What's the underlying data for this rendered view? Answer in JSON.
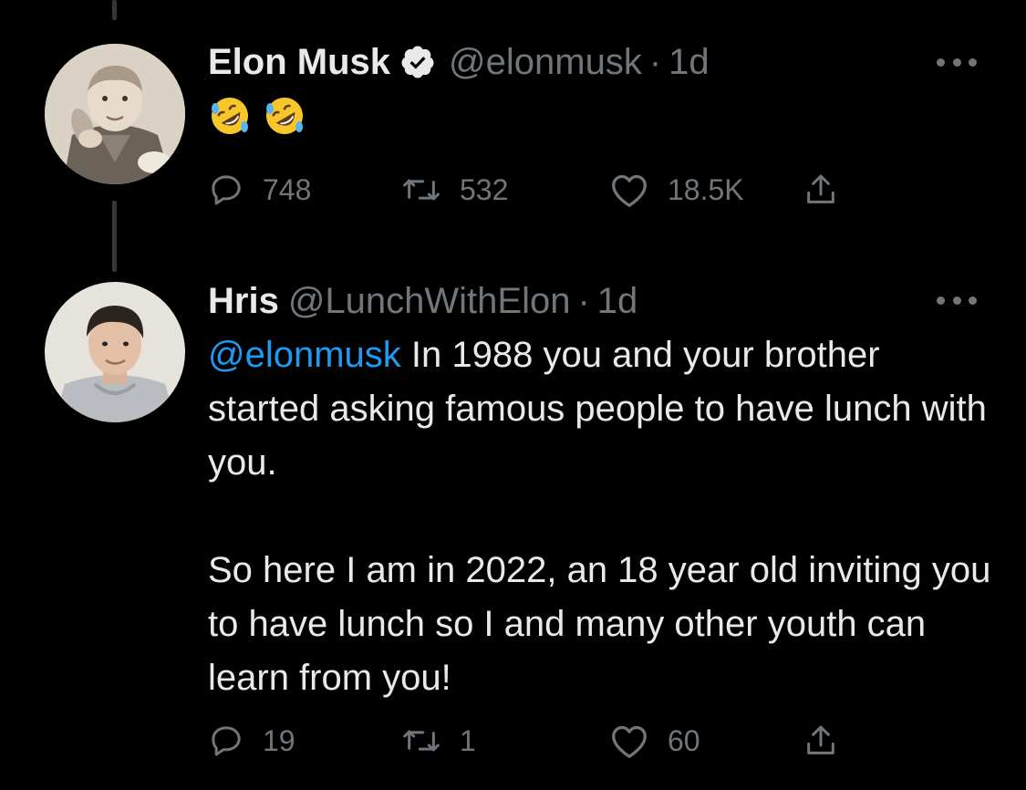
{
  "colors": {
    "background": "#000000",
    "text_primary": "#e7e9ea",
    "text_secondary": "#71767b",
    "link": "#1d9bf0",
    "verified_badge": "#e7e9ea",
    "thread_line": "#333639"
  },
  "tweets": [
    {
      "author": {
        "name": "Elon Musk",
        "handle": "@elonmusk",
        "verified": true,
        "avatar_icon": "avatar-child-photo"
      },
      "separator": "·",
      "time": "1d",
      "content": {
        "emojis": [
          "rolling-on-floor-laughing-emoji",
          "rolling-on-floor-laughing-emoji"
        ]
      },
      "actions": {
        "reply_count": "748",
        "retweet_count": "532",
        "like_count": "18.5K"
      }
    },
    {
      "author": {
        "name": "Hris",
        "handle": "@LunchWithElon",
        "verified": false,
        "avatar_icon": "avatar-young-man-photo"
      },
      "separator": "·",
      "time": "1d",
      "content": {
        "mention": "@elonmusk",
        "paragraph1_rest": " In 1988 you and your brother started asking famous people to have lunch with you.",
        "paragraph2": "So here I am in 2022, an 18 year old inviting you to have lunch so I and many other youth can learn from you!"
      },
      "actions": {
        "reply_count": "19",
        "retweet_count": "1",
        "like_count": "60"
      }
    }
  ]
}
